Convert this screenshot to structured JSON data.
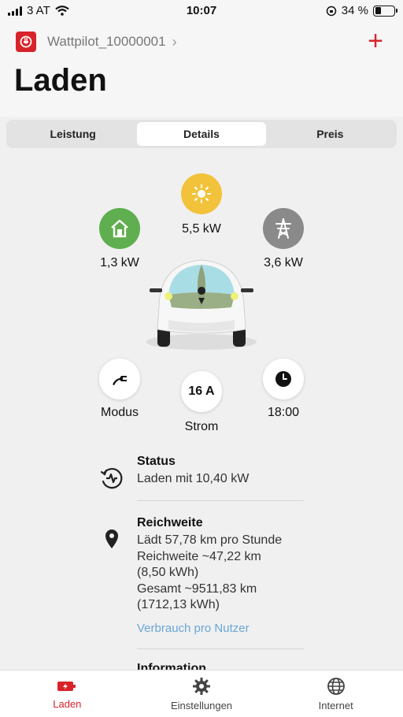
{
  "status_bar": {
    "carrier": "3 AT",
    "time": "10:07",
    "battery_percent": "34 %",
    "battery_level": 0.34
  },
  "header": {
    "device_name": "Wattpilot_10000001",
    "title": "Laden"
  },
  "tabs": [
    {
      "label": "Leistung",
      "active": false
    },
    {
      "label": "Details",
      "active": true
    },
    {
      "label": "Preis",
      "active": false
    }
  ],
  "flow": {
    "solar": "5,5 kW",
    "house": "1,3 kW",
    "grid": "3,6 kW"
  },
  "controls": {
    "mode_label": "Modus",
    "current_value": "16 A",
    "current_label": "Strom",
    "time_value": "18:00"
  },
  "status": {
    "title": "Status",
    "text": "Laden mit 10,40 kW"
  },
  "range": {
    "title": "Reichweite",
    "lines": [
      "Lädt 57,78 km pro Stunde",
      "Reichweite ~47,22 km",
      "(8,50 kWh)",
      "Gesamt ~9511,83 km",
      "(1712,13 kWh)"
    ],
    "link": "Verbrauch pro Nutzer"
  },
  "info": {
    "title": "Information"
  },
  "bottom_nav": [
    {
      "label": "Laden",
      "icon": "charging-icon",
      "active": true
    },
    {
      "label": "Einstellungen",
      "icon": "gear-icon",
      "active": false
    },
    {
      "label": "Internet",
      "icon": "globe-icon",
      "active": false
    }
  ],
  "colors": {
    "accent": "#d8232a",
    "solar": "#f2c23a",
    "house": "#5fae4f",
    "grid": "#8a8a8a",
    "link": "#6aa6d6"
  }
}
